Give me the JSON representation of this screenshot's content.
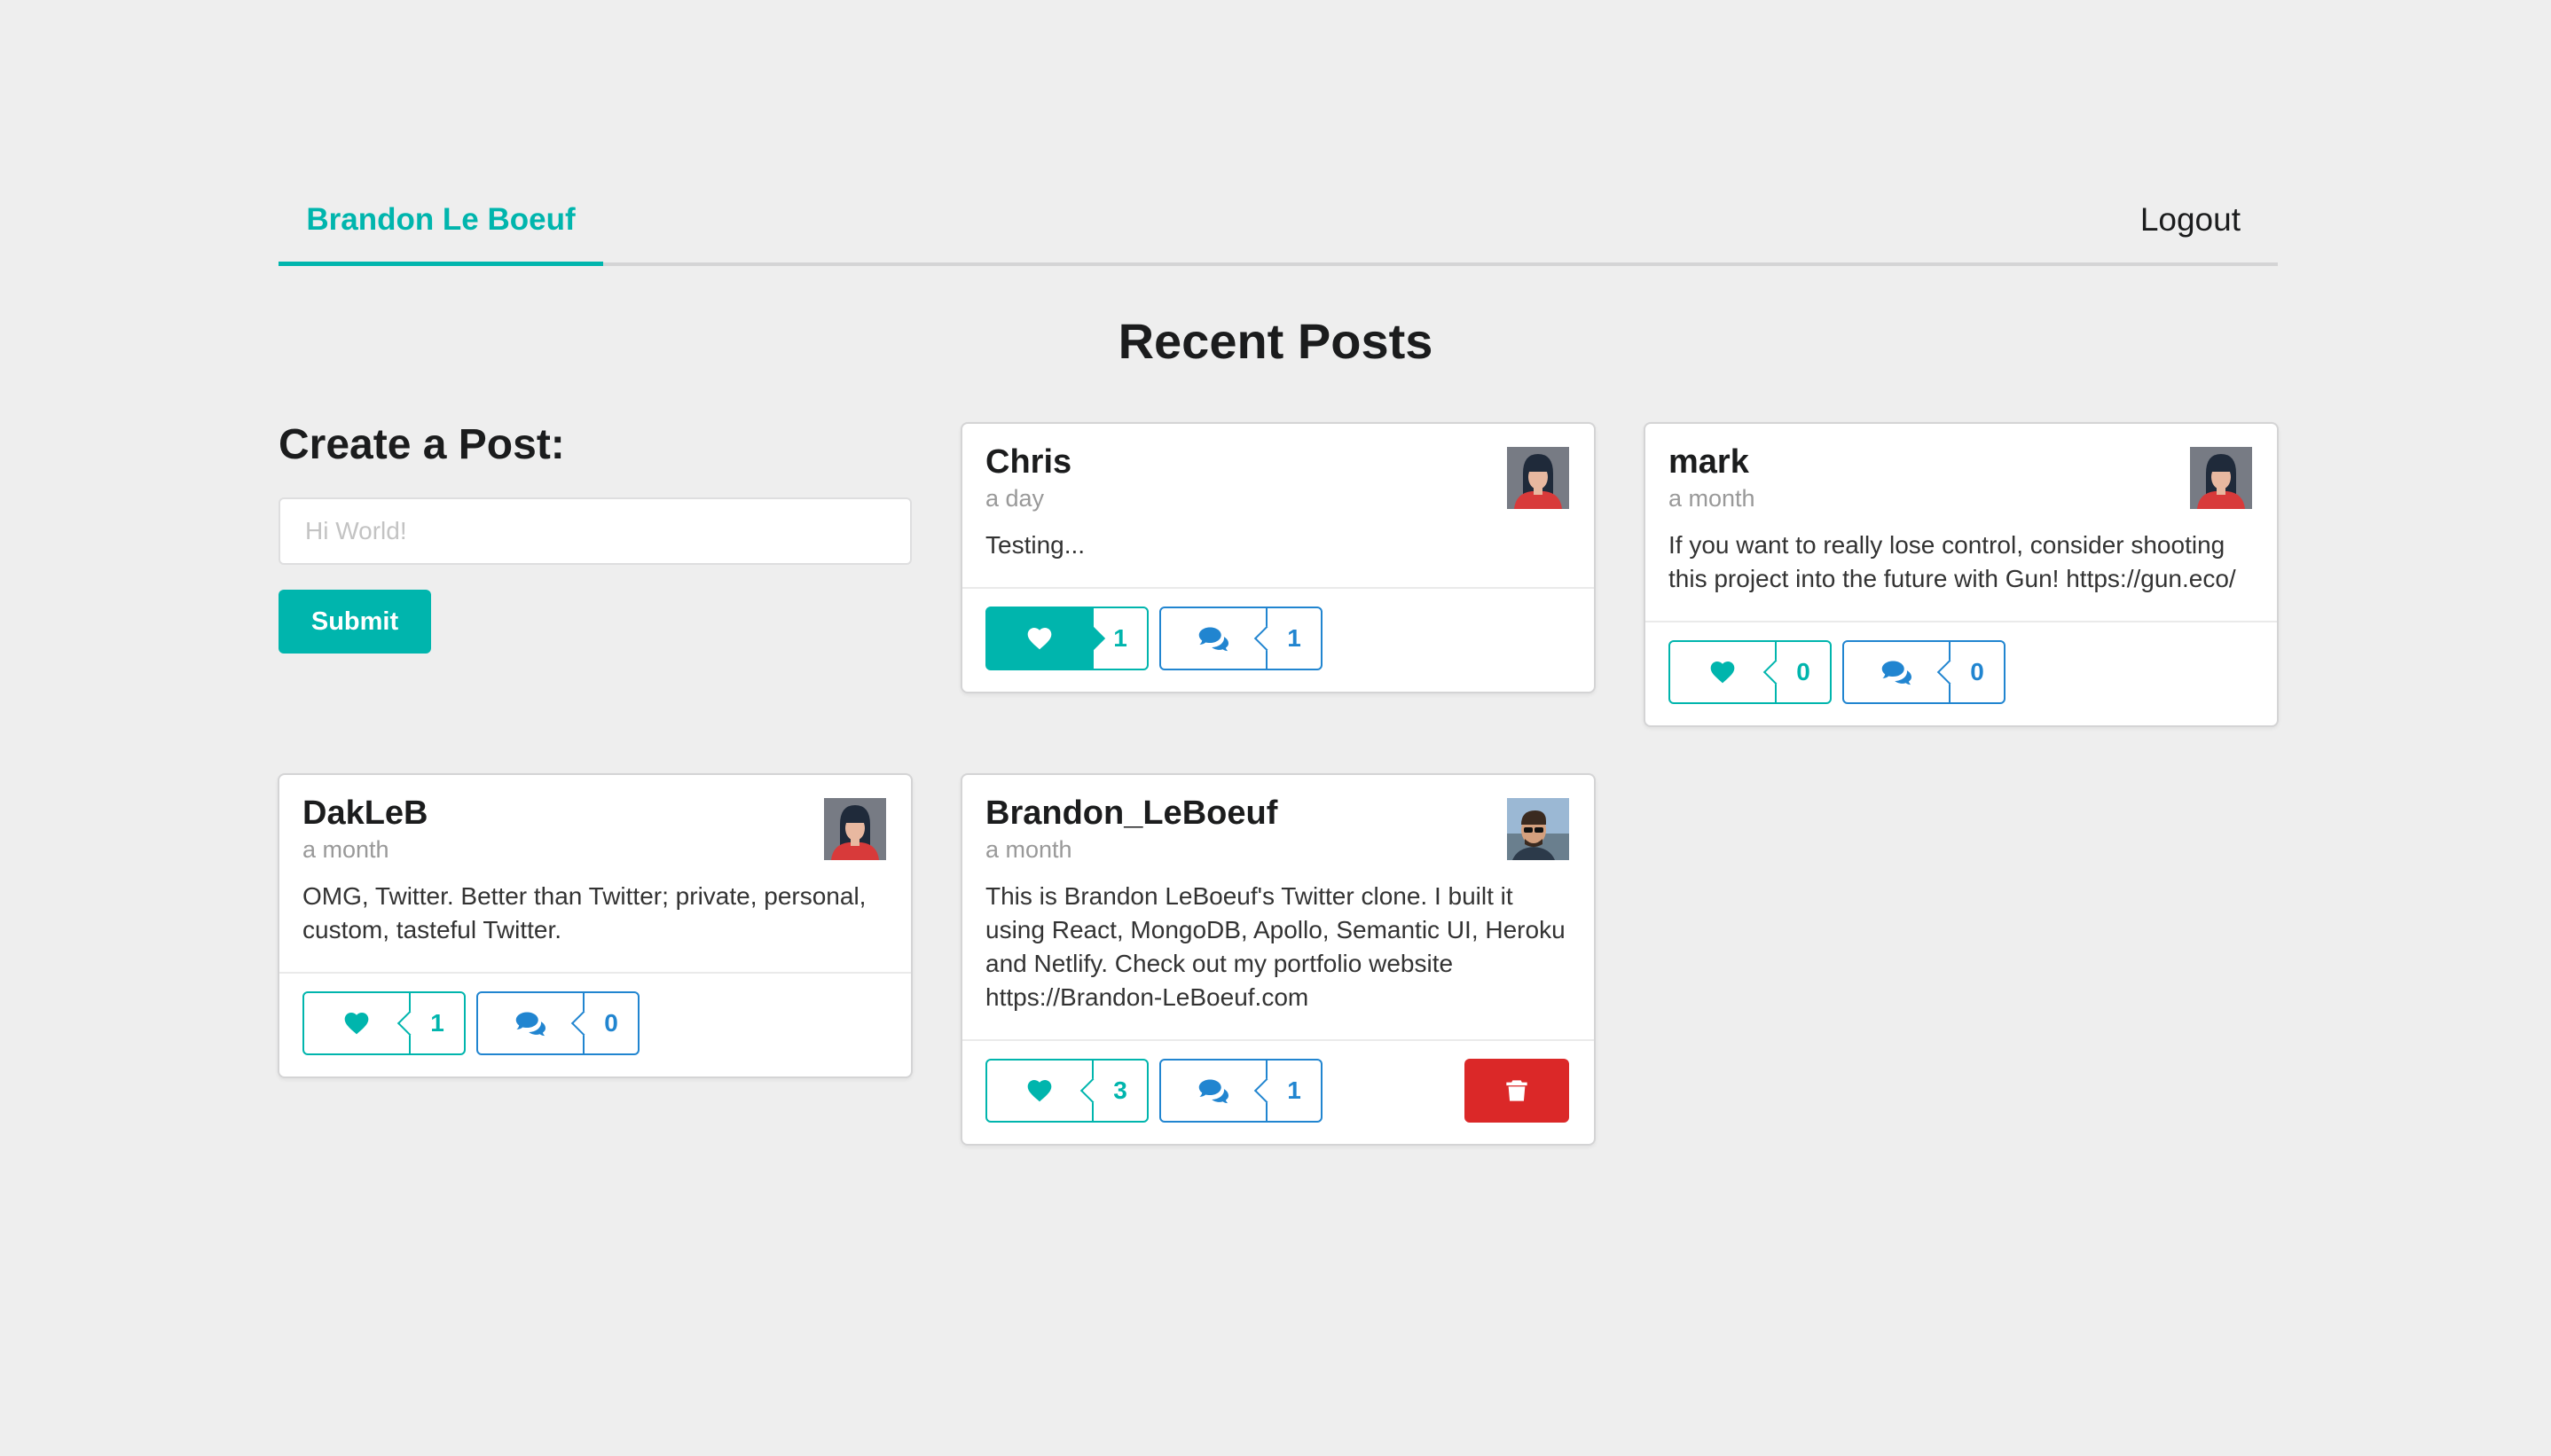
{
  "menu": {
    "active_item": "Brandon Le Boeuf",
    "logout": "Logout"
  },
  "page_title": "Recent Posts",
  "create_post": {
    "title": "Create a Post:",
    "placeholder": "Hi World!",
    "submit": "Submit"
  },
  "posts": [
    {
      "username": "Chris",
      "time": "a day",
      "body": "Testing...",
      "likes": "1",
      "comments": "1",
      "liked": true,
      "avatar": "woman-avatar",
      "can_delete": false
    },
    {
      "username": "mark",
      "time": "a month",
      "body": "If you want to really lose control, consider shooting this project into the future with Gun! https://gun.eco/",
      "likes": "0",
      "comments": "0",
      "liked": false,
      "avatar": "woman-avatar",
      "can_delete": false
    },
    {
      "username": "DakLeB",
      "time": "a month",
      "body": "OMG, Twitter. Better than Twitter; private, personal, custom, tasteful Twitter.",
      "likes": "1",
      "comments": "0",
      "liked": false,
      "avatar": "woman-avatar",
      "can_delete": false
    },
    {
      "username": "Brandon_LeBoeuf",
      "time": "a month",
      "body": "This is Brandon LeBoeuf's Twitter clone. I built it using React, MongoDB, Apollo, Semantic UI, Heroku and Netlify. Check out my portfolio website https://Brandon-LeBoeuf.com",
      "likes": "3",
      "comments": "1",
      "liked": false,
      "avatar": "man-photo-avatar",
      "can_delete": true
    }
  ],
  "colors": {
    "teal": "#00b5ad",
    "blue": "#2185d0",
    "red": "#db2828",
    "background": "#eeeeee"
  },
  "icons": {
    "like": "heart-icon",
    "comment": "comments-icon",
    "delete": "trash-icon"
  }
}
